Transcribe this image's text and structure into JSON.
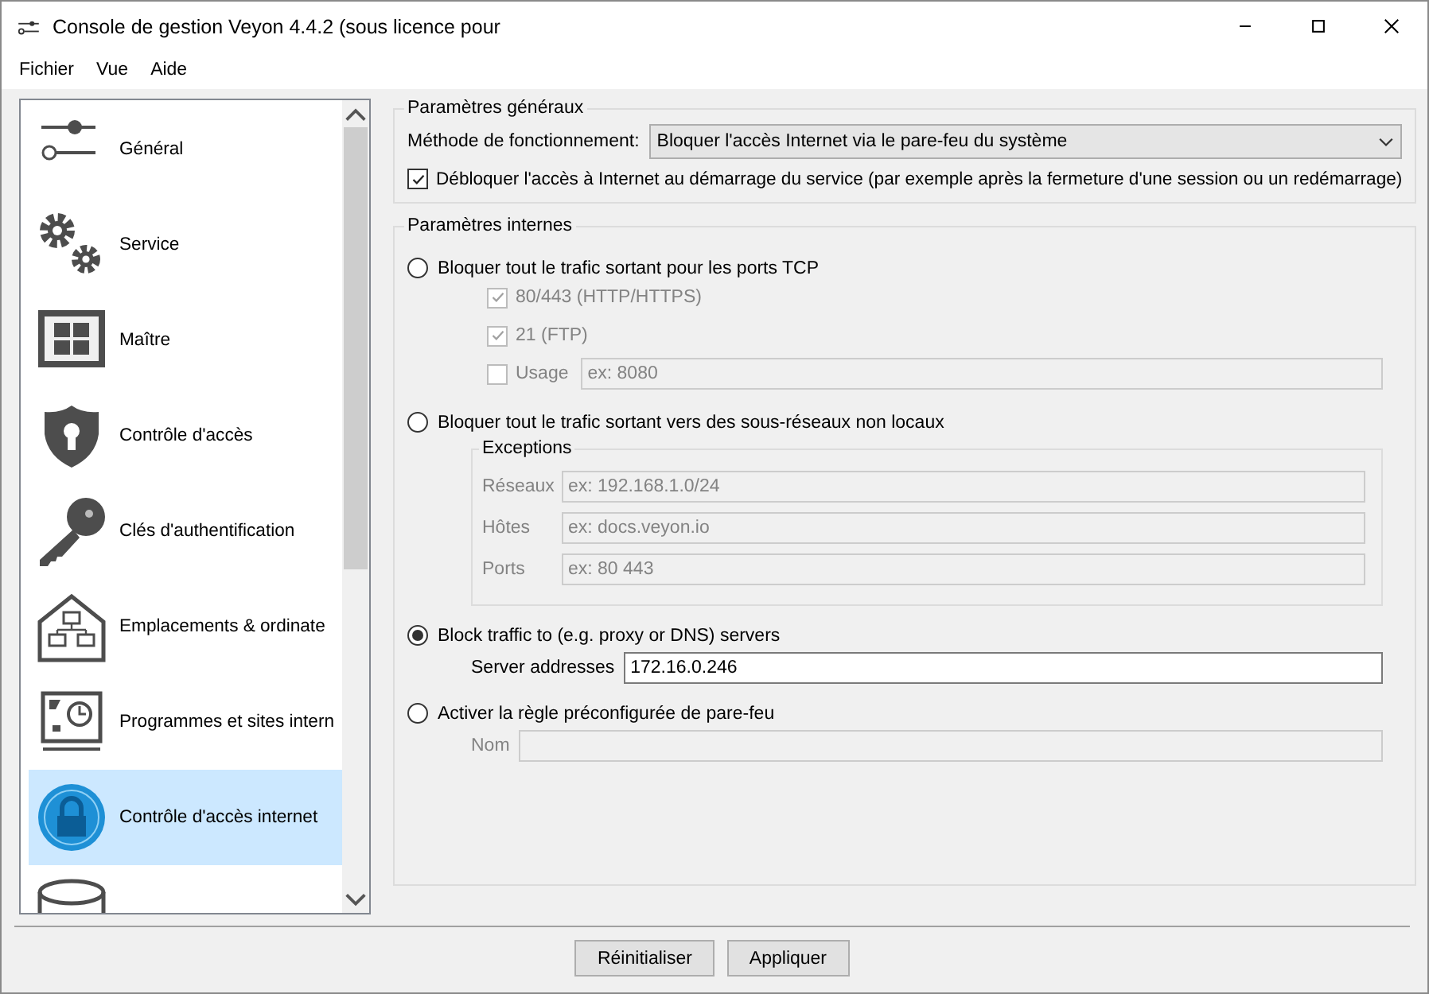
{
  "window": {
    "title": "Console de gestion Veyon 4.4.2 (sous licence pour"
  },
  "menu": [
    "Fichier",
    "Vue",
    "Aide"
  ],
  "sidebar": {
    "items": [
      {
        "label": "Général",
        "selected": false
      },
      {
        "label": "Service",
        "selected": false
      },
      {
        "label": "Maître",
        "selected": false
      },
      {
        "label": "Contrôle d'accès",
        "selected": false
      },
      {
        "label": "Clés d'authentification",
        "selected": false
      },
      {
        "label": "Emplacements & ordinate",
        "selected": false
      },
      {
        "label": "Programmes et sites intern",
        "selected": false
      },
      {
        "label": "Contrôle d'accès internet",
        "selected": true
      },
      {
        "selected": false
      }
    ]
  },
  "general": {
    "title": "Paramètres généraux",
    "method_label": "Méthode de fonctionnement:",
    "method_value": "Bloquer l'accès Internet via le pare-feu du système",
    "unblock": {
      "label": "Débloquer l'accès à Internet au démarrage du service (par exemple après la fermeture d'une session ou un redémarrage)",
      "checked": true
    }
  },
  "internal": {
    "title": "Paramètres internes",
    "options": [
      {
        "kind": "ports",
        "label": "Bloquer tout le trafic sortant pour les ports TCP",
        "selected": false,
        "ports": [
          {
            "label": "80/443 (HTTP/HTTPS)",
            "checked": true,
            "disabled": true
          },
          {
            "label": "21 (FTP)",
            "checked": true,
            "disabled": true
          },
          {
            "label": "Usage",
            "checked": false,
            "disabled": true,
            "placeholder": "ex: 8080"
          }
        ]
      },
      {
        "kind": "exceptions",
        "label": "Bloquer tout le trafic sortant vers des sous-réseaux non locaux",
        "selected": false,
        "group_title": "Exceptions",
        "fields": [
          {
            "label": "Réseaux",
            "placeholder": "ex: 192.168.1.0/24",
            "disabled": true
          },
          {
            "label": "Hôtes",
            "placeholder": "ex: docs.veyon.io",
            "disabled": true
          },
          {
            "label": "Ports",
            "placeholder": "ex: 80 443",
            "disabled": true
          }
        ]
      },
      {
        "kind": "fields",
        "label": "Block traffic to (e.g. proxy or DNS) servers",
        "selected": true,
        "fields": [
          {
            "label": "Server addresses",
            "value": "172.16.0.246",
            "disabled": false
          }
        ]
      },
      {
        "kind": "fields",
        "label": "Activer la règle préconfigurée de pare-feu",
        "selected": false,
        "fields": [
          {
            "label": "Nom",
            "disabled": true
          }
        ]
      }
    ]
  },
  "buttons": [
    "Réinitialiser",
    "Appliquer"
  ]
}
